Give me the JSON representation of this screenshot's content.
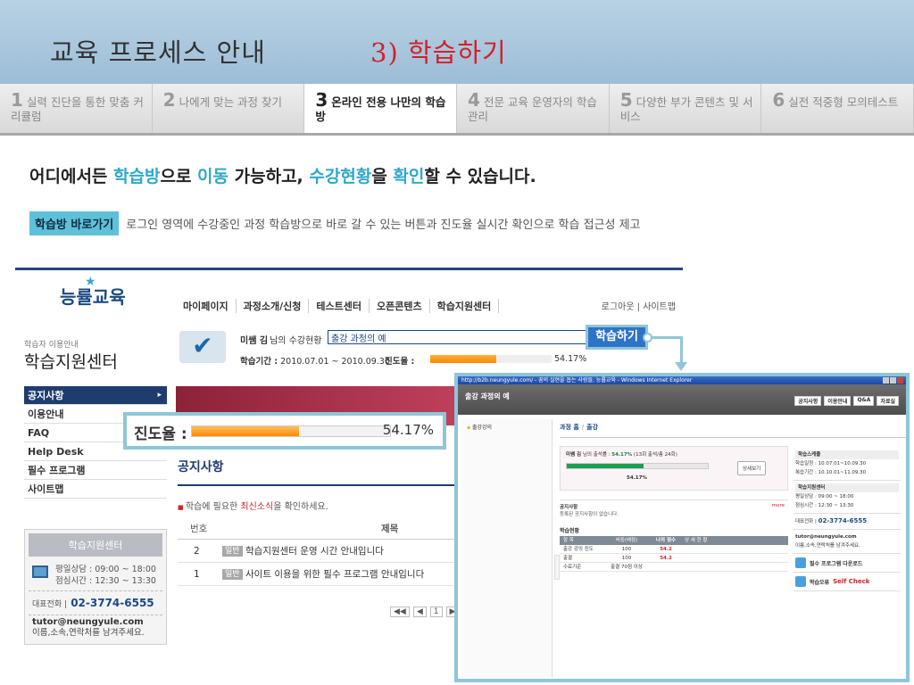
{
  "header": {
    "title": "교육 프로세스 안내",
    "subtitle": "3) 학습하기"
  },
  "tabs": [
    {
      "num": "1",
      "label": "실력 진단을 통한 맞춤 커리큘럼",
      "active": false
    },
    {
      "num": "2",
      "label": "나에게 맞는 과정 찾기",
      "active": false
    },
    {
      "num": "3",
      "label": "온라인 전용 나만의 학습방",
      "active": true
    },
    {
      "num": "4",
      "label": "전문 교육 운영자의 학습 관리",
      "active": false
    },
    {
      "num": "5",
      "label": "다양한 부가 콘텐츠 및 서비스",
      "active": false
    },
    {
      "num": "6",
      "label": "실전 적중형 모의테스트",
      "active": false
    }
  ],
  "headline": {
    "p1": "어디에서든 ",
    "h1": "학습방",
    "p2": "으로 ",
    "h2": "이동",
    "p3": " 가능하고, ",
    "h3": "수강현황",
    "p4": "을 ",
    "h4": "확인",
    "p5": "할 수 있습니다."
  },
  "note": {
    "badge": "학습방 바로가기",
    "text": "로그인 영역에 수강중인 과정 학습방으로 바로 갈 수 있는 버튼과 진도율 실시간 확인으로 학습 접근성 제고"
  },
  "site": {
    "logo": "능률교육",
    "topnav": [
      "마이페이지",
      "과정소개/신청",
      "테스트센터",
      "오픈콘텐츠",
      "학습지원센터"
    ],
    "utilnav": "로그아웃 | 사이트맵",
    "side_sub": "학습자 이용안내",
    "side_title": "학습지원센터",
    "sidemenu": [
      "공지사항",
      "이용안내",
      "FAQ",
      "Help Desk",
      "필수 프로그램",
      "사이트맵"
    ],
    "support": {
      "head": "학습지원센터",
      "hours_1": "평일상담 : 09:00 ~ 18:00",
      "hours_2": "점심시간 : 12:30 ~ 13:30",
      "tel_label": "대표전화 |",
      "tel": "02-3774-6555",
      "email": "tutor@neungyule.com",
      "email_note": "이름,소속,연락처를 남겨주세요."
    },
    "status": {
      "name": "미쌤 김",
      "name_suffix": "님의 수강현황",
      "course": "출강 과정의 예",
      "period_label": "학습기간 :",
      "period": "2010.07.01 ~ 2010.09.30",
      "progress_label": "진도율 :",
      "progress_value": "54.17%",
      "progress_fraction": 0.5417
    },
    "goto_button": "학습하기",
    "notice_title": "공지사항",
    "notice_help_1": "학습에 필요한 ",
    "notice_help_red": "최신소식",
    "notice_help_2": "을 확인하세요.",
    "table_headers": [
      "번호",
      "제목"
    ],
    "rows": [
      {
        "num": "2",
        "tag": "일반",
        "title": "학습지원센터 운영 시간 안내입니다"
      },
      {
        "num": "1",
        "tag": "일반",
        "title": "사이트 이용을 위한 필수 프로그램 안내입니다"
      }
    ],
    "pager": [
      "◀◀",
      "◀",
      "1",
      "▶"
    ]
  },
  "progress_callout": {
    "label": "진도율 :",
    "value": "54.17%",
    "fraction": 0.5417
  },
  "popup": {
    "ie_title": "http://b2b.neungyule.com/ - 꿈의 실현을 돕는 사람들, 능률교육 - Windows Internet Explorer",
    "app_title": "출강 과정의 예",
    "app_links": [
      "공지사항",
      "이용안내",
      "Q&A",
      "자료실"
    ],
    "left_item": "출강강의",
    "crumb_a": "과정 홈",
    "crumb_sep": "/",
    "crumb_b": "출강",
    "prog_who": "미쌤 김",
    "prog_text": " 님의 출석률 : ",
    "prog_rate": "54.17%",
    "prog_detail": " (13회 출석/총 24회)",
    "prog_pct": "54.17%",
    "prog_fraction": 0.5417,
    "detail_button": "상세보기",
    "notice_head": "공지사항",
    "notice_more": "more",
    "notice_empty": "등록된 공지사항이 없습니다.",
    "stat_title": "학습현황",
    "stat_headers": [
      "항 목",
      "비중(배점)",
      "나의 점수",
      "상 세 현 황"
    ],
    "stat_rows": [
      {
        "a": "출강 강의 진도",
        "b": "100",
        "c": "54.2",
        "d": ""
      },
      {
        "a": "출결",
        "b": "100",
        "c": "54.2",
        "d": ""
      },
      {
        "a": "수료기준",
        "b": "출결 70점 이상",
        "c": "",
        "d": ""
      }
    ],
    "sched_head": "학습스케줄",
    "sched_1": "학습일정 : 10.07.01~10.09.30",
    "sched_2": "복습기간 : 10.10.01~11.09.30",
    "support_head": "학습지원센터",
    "support_1": "평일상담 : 09:00 ~ 18:00",
    "support_2": "점심시간 : 12:30 ~ 13:30",
    "tel_label": "대표전화 |",
    "tel": "02-3774-6555",
    "email": "tutor@neungyule.com",
    "email_note": "이름,소속,연락처를 남겨주세요.",
    "download": "필수 프로그램 다운로드",
    "selfcheck_a": "학습오류 ",
    "selfcheck_b": "Self Check"
  }
}
